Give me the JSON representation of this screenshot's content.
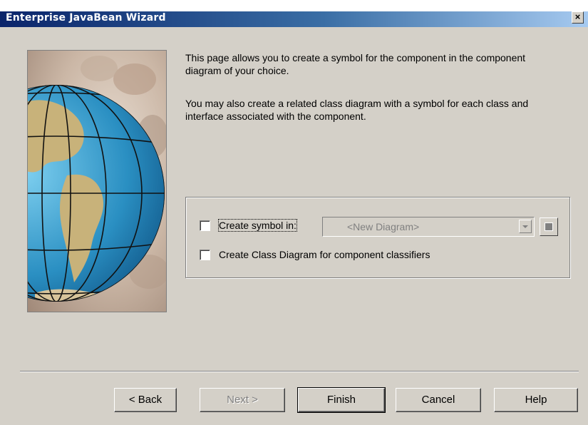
{
  "window": {
    "title": "Enterprise JavaBean Wizard",
    "close_label": "×"
  },
  "description": {
    "paragraph1": "This page allows you to create a symbol for the component in the component diagram of your choice.",
    "paragraph2": "You may also create a related class diagram with a symbol for each class and interface associated with the component."
  },
  "options": {
    "create_symbol": {
      "label": "Create symbol in:",
      "checked": false
    },
    "diagram_combo": {
      "value": "<New Diagram>",
      "enabled": false
    },
    "create_class_diagram": {
      "label": "Create Class Diagram for component classifiers",
      "checked": false
    }
  },
  "buttons": {
    "back": "< Back",
    "next": "Next >",
    "finish": "Finish",
    "cancel": "Cancel",
    "help": "Help"
  },
  "colors": {
    "titlebar_start": "#0a246a",
    "titlebar_end": "#a6caf0",
    "dialog_bg": "#d4d0c8"
  },
  "icons": [
    "close-icon",
    "globe-image",
    "dropdown-arrow-icon",
    "properties-icon"
  ]
}
